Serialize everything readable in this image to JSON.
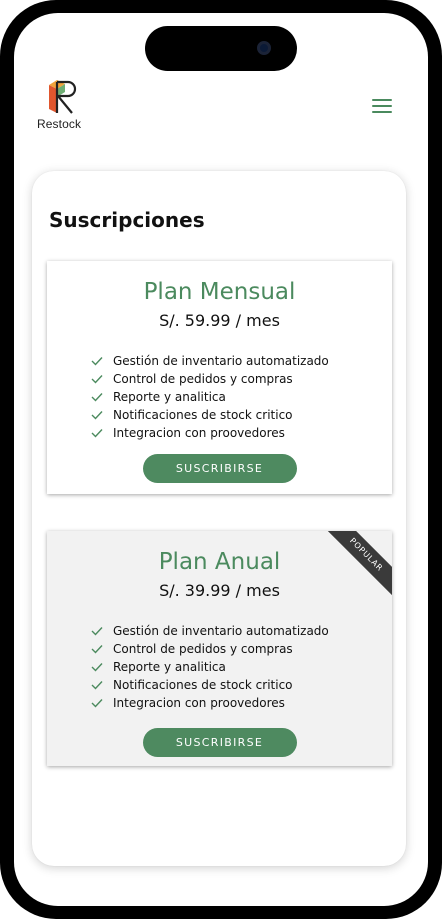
{
  "brand": {
    "name": "Restock"
  },
  "header": {
    "menu_icon": "hamburger-menu-icon"
  },
  "colors": {
    "accent": "#4e8a60",
    "ribbon": "#3a3a3a",
    "frame": "#000000"
  },
  "page": {
    "title": "Suscripciones"
  },
  "plans": [
    {
      "name": "Plan Mensual",
      "price": "S/. 59.99 / mes",
      "features": [
        "Gestión de inventario automatizado",
        "Control de pedidos y compras",
        "Reporte y analitica",
        "Notificaciones de stock critico",
        "Integracion con proovedores"
      ],
      "button_label": "SUSCRIBIRSE"
    },
    {
      "name": "Plan Anual",
      "price": "S/. 39.99 / mes",
      "badge": "POPULAR",
      "features": [
        "Gestión de inventario automatizado",
        "Control de pedidos y compras",
        "Reporte y analitica",
        "Notificaciones de stock critico",
        "Integracion con proovedores"
      ],
      "button_label": "SUSCRIBIRSE"
    }
  ]
}
